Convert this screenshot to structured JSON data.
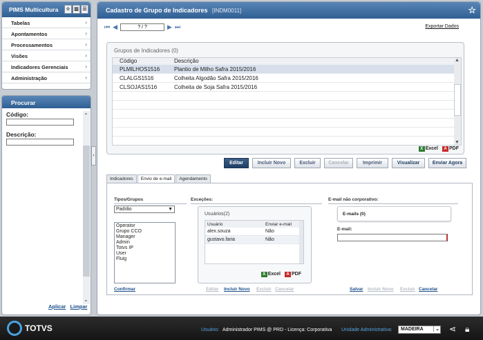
{
  "sidebar": {
    "title": "PIMS Multicultura",
    "menu": [
      "Tabelas",
      "Apontamentos",
      "Processamentos",
      "Visões",
      "Indicadores Gerenciais",
      "Administração"
    ]
  },
  "search": {
    "title": "Procurar",
    "codigo_label": "Código:",
    "descricao_label": "Descrição:",
    "apply": "Aplicar",
    "clear": "Limpar"
  },
  "main": {
    "title": "Cadastro de Grupo de Indicadores",
    "code": "[INDM0011]",
    "pager_value": "? / ?",
    "export": "Exportar Dados",
    "grid": {
      "title": "Grupos de Indicadores (0)",
      "columns": [
        "Código",
        "Descrição"
      ],
      "rows": [
        [
          "PLMILHOS1516",
          "Plantio de Milho Safra 2015/2016"
        ],
        [
          "CLALGS1516",
          "Colheita Algodão Safra 2015/2016"
        ],
        [
          "CLSOJAS1516",
          "Colheita de Soja Safra 2015/2016"
        ]
      ]
    },
    "excel": "Excel",
    "pdf": "PDF",
    "buttons": [
      "Editar",
      "Incluir Novo",
      "Excluir",
      "Cancelar",
      "Imprimir",
      "Visualizar",
      "Enviar Agora"
    ],
    "tabs": [
      "Indicadores",
      "Envio de e-mail",
      "Agendamento"
    ]
  },
  "email_tab": {
    "tipos_title": "Tipos/Grupos",
    "select_value": "Padrão",
    "groups": [
      "Operator",
      "Grupo CCO",
      "Manager",
      "Admin",
      "Totvs IP",
      "User",
      "Fluig"
    ],
    "confirm": "Confirmar",
    "excecoes_title": "Exceções:",
    "users_title": "Usuários(2)",
    "user_columns": [
      "Usuário",
      "Enviar e-mail"
    ],
    "users": [
      [
        "alex.souza",
        "Não"
      ],
      [
        "gustavo.faria",
        "Não"
      ]
    ],
    "user_links": [
      "Editar",
      "Incluir Novo",
      "Excluir",
      "Cancelar"
    ],
    "nao_corp_title": "E-mail não corporativo:",
    "emails_count": "E-mails (0)",
    "email_label": "E-mail:",
    "email_links": [
      "Salvar",
      "Incluir Novo",
      "Excluir",
      "Cancelar"
    ]
  },
  "status": {
    "brand": "TOTVS",
    "user_label": "Usuário:",
    "user_value": "Administrador PIMS @ PRD - Licença: Corporativa",
    "unit_label": "Unidade Administrativa:",
    "unit_value": "MADEIRA"
  }
}
